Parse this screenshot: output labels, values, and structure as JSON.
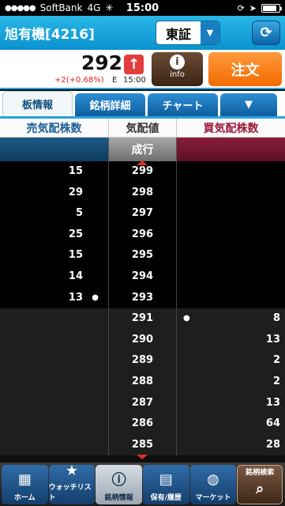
{
  "status_bar": {
    "carrier": "SoftBank",
    "network": "4G",
    "time": "15:00"
  },
  "header": {
    "stock_title": "旭有機[4216]",
    "exchange": "東証"
  },
  "quote": {
    "price": "292",
    "change": "+2(+0.68%)",
    "exchange_flag": "E",
    "time": "15:00",
    "info_label": "info",
    "order_label": "注文"
  },
  "tabs": [
    {
      "label": "板情報"
    },
    {
      "label": "銘柄詳細"
    },
    {
      "label": "チャート"
    }
  ],
  "columns": {
    "sell": "売気配株数",
    "price": "気配値",
    "buy": "買気配株数"
  },
  "market_label": "成行",
  "order_book": [
    {
      "sell": "15",
      "price": "299",
      "buy": ""
    },
    {
      "sell": "29",
      "price": "298",
      "buy": ""
    },
    {
      "sell": "5",
      "price": "297",
      "buy": ""
    },
    {
      "sell": "25",
      "price": "296",
      "buy": ""
    },
    {
      "sell": "15",
      "price": "295",
      "buy": ""
    },
    {
      "sell": "14",
      "price": "294",
      "buy": ""
    },
    {
      "sell": "13",
      "price": "293",
      "buy": ""
    },
    {
      "sell": "",
      "price": "291",
      "buy": "8"
    },
    {
      "sell": "",
      "price": "290",
      "buy": "13"
    },
    {
      "sell": "",
      "price": "289",
      "buy": "2"
    },
    {
      "sell": "",
      "price": "288",
      "buy": "2"
    },
    {
      "sell": "",
      "price": "287",
      "buy": "13"
    },
    {
      "sell": "",
      "price": "286",
      "buy": "64"
    },
    {
      "sell": "",
      "price": "285",
      "buy": "28"
    }
  ],
  "bottom_nav": [
    {
      "label": "ホーム",
      "icon": "home-grid-icon"
    },
    {
      "label": "ウォッチリスト",
      "icon": "watchlist-star-icon"
    },
    {
      "label": "銘柄情報",
      "icon": "stock-info-icon"
    },
    {
      "label": "保有/履歴",
      "icon": "clipboard-icon"
    },
    {
      "label": "マーケット",
      "icon": "globe-icon"
    },
    {
      "label": "銘柄検索",
      "icon": "search-magnifier-icon"
    }
  ]
}
